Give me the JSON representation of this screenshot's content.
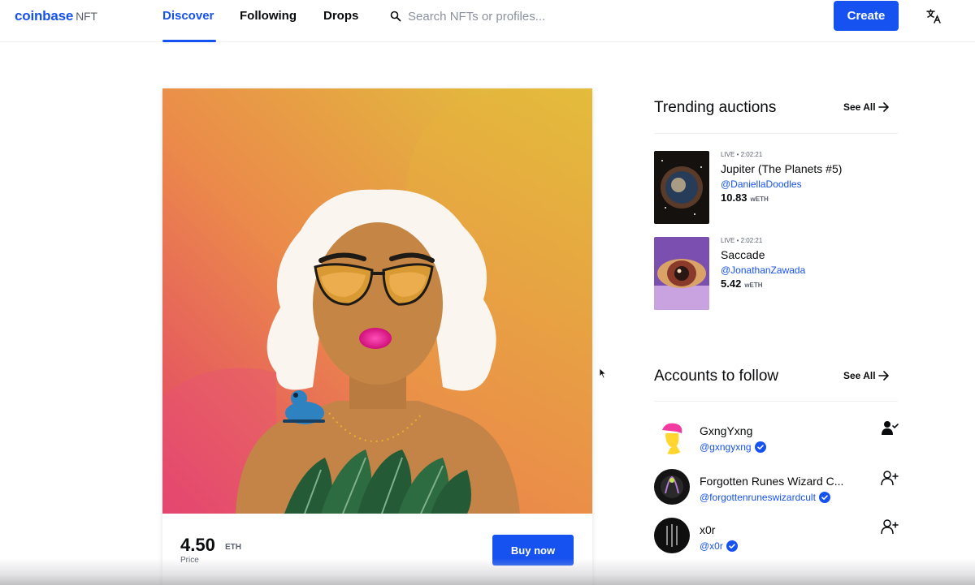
{
  "brand": {
    "name": "coinbase",
    "suffix": "NFT"
  },
  "nav": {
    "tabs": [
      {
        "label": "Discover",
        "active": true
      },
      {
        "label": "Following",
        "active": false
      },
      {
        "label": "Drops",
        "active": false
      }
    ],
    "search_placeholder": "Search NFTs or profiles...",
    "create_label": "Create",
    "language_icon": "translate-icon"
  },
  "featured": {
    "price": "4.50",
    "currency": "ETH",
    "price_label": "Price",
    "buy_label": "Buy now"
  },
  "trending": {
    "title": "Trending auctions",
    "see_all": "See All",
    "items": [
      {
        "status": "LIVE • 2:02:21",
        "title": "Jupiter (The Planets #5)",
        "creator": "@DaniellaDoodles",
        "amount": "10.83",
        "unit": "wETH"
      },
      {
        "status": "LIVE • 2:02:21",
        "title": "Saccade",
        "creator": "@JonathanZawada",
        "amount": "5.42",
        "unit": "wETH"
      }
    ]
  },
  "accounts": {
    "title": "Accounts to follow",
    "see_all": "See All",
    "items": [
      {
        "name": "GxngYxng",
        "handle": "@gxngyxng",
        "following": true
      },
      {
        "name": "Forgotten Runes Wizard C...",
        "handle": "@forgottenruneswizardcult",
        "following": false
      },
      {
        "name": "x0r",
        "handle": "@x0r",
        "following": false
      }
    ]
  },
  "colors": {
    "accent": "#1652f0",
    "text": "#0a0b0d",
    "muted": "#5b616e"
  }
}
